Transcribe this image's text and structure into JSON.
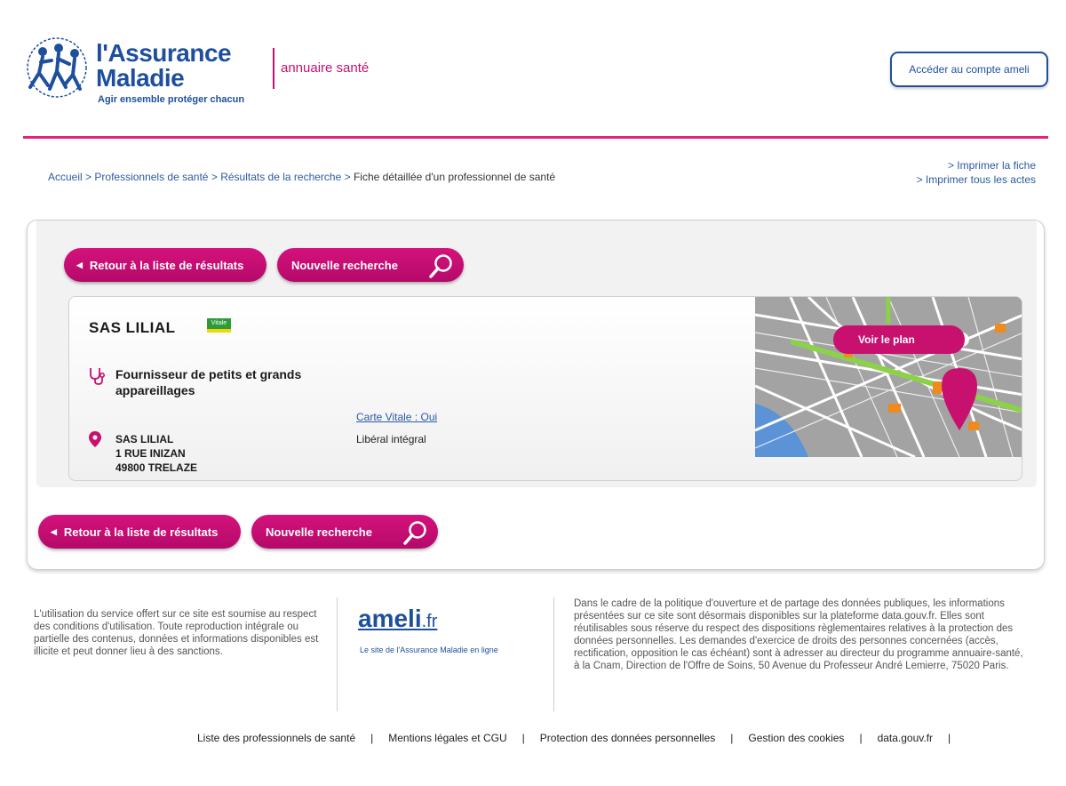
{
  "header": {
    "logo_title_line1": "l'Assurance",
    "logo_title_line2": "Maladie",
    "logo_tagline": "Agir ensemble  protéger chacun",
    "service_name": "annuaire santé",
    "account_button": "Accéder au compte ameli",
    "brand_color": "#1e4f9e",
    "accent_color": "#c8106e"
  },
  "breadcrumb": {
    "items": [
      "Accueil",
      "Professionnels de santé",
      "Résultats de la recherche"
    ],
    "separator": ">",
    "current": "Fiche détaillée d'un professionnel de santé"
  },
  "print_links": {
    "print_sheet": "> Imprimer la fiche",
    "print_all": "> Imprimer tous les actes"
  },
  "actions": {
    "back_label": "Retour à la liste de résultats",
    "new_search_label": "Nouvelle recherche"
  },
  "professional": {
    "name": "SAS LILIAL",
    "vitale_badge": "Vitale",
    "specialty": "Fournisseur de petits et grands appareillages",
    "address_line1": "SAS LILIAL",
    "address_line2": "1 RUE INIZAN",
    "address_line3": "49800 TRELAZE",
    "vitale_card": "Carte Vitale : Oui",
    "convention": "Libéral intégral"
  },
  "map": {
    "button_label": "Voir le plan"
  },
  "footer": {
    "legal_text": "L'utilisation du service offert sur ce site est soumise au respect des conditions d'utilisation. Toute reproduction intégrale ou partielle des contenus, données et informations disponibles est illicite et peut donner lieu à des sanctions.",
    "ameli_logo": "ameli",
    "ameli_logo_suffix": ".fr",
    "ameli_tagline": "Le site de l'Assurance Maladie en ligne",
    "opendata_text": "Dans le cadre de la politique d'ouverture et de partage des données publiques, les informations présentées sur ce site sont désormais disponibles sur la plateforme data.gouv.fr. Elles sont réutilisables sous réserve du respect des dispositions règlementaires relatives à la protection des données personnelles. Les demandes d'exercice de droits des personnes concernées (accès, rectification, opposition le cas échéant) sont à adresser au directeur du programme annuaire-santé, à la Cnam, Direction de l'Offre de Soins, 50 Avenue du Professeur André Lemierre, 75020 Paris.",
    "links": [
      "Liste des professionnels de santé",
      "Mentions légales et CGU",
      "Protection des données personnelles",
      "Gestion des cookies",
      "data.gouv.fr"
    ],
    "link_separator": "|"
  }
}
